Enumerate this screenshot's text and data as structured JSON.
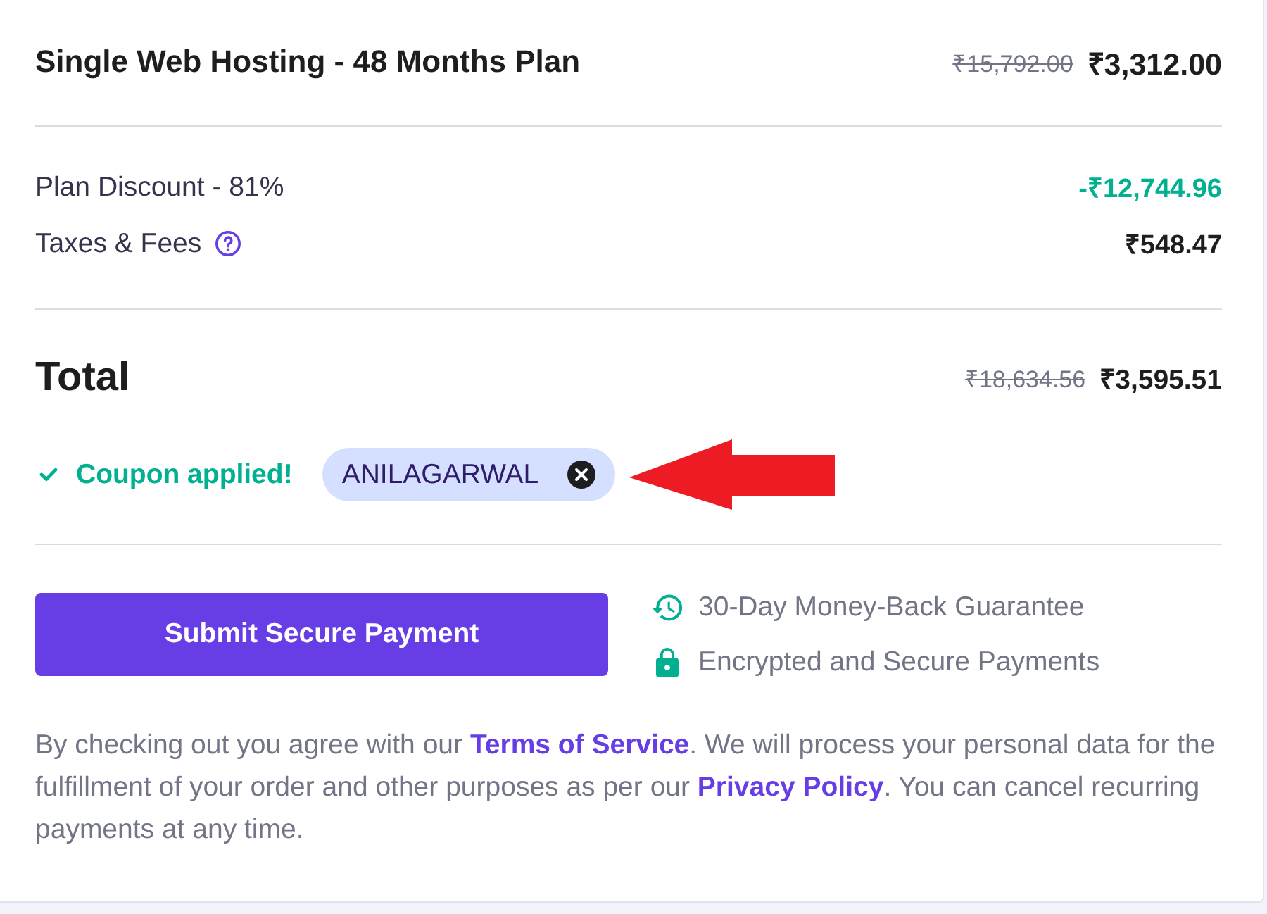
{
  "plan": {
    "name": "Single Web Hosting - 48 Months Plan",
    "original_price": "₹15,792.00",
    "price": "₹3,312.00"
  },
  "charges": [
    {
      "label": "Plan Discount - 81%",
      "amount": "-₹12,744.96",
      "kind": "discount",
      "help": false
    },
    {
      "label": "Taxes & Fees",
      "amount": "₹548.47",
      "kind": "fee",
      "help": true
    }
  ],
  "total": {
    "label": "Total",
    "original_price": "₹18,634.56",
    "price": "₹3,595.51"
  },
  "coupon": {
    "message": "Coupon applied!",
    "code": "ANILAGARWAL"
  },
  "submit_button": {
    "label": "Submit Secure Payment"
  },
  "assurances": [
    {
      "text": "30-Day Money-Back Guarantee",
      "kind": "money-back"
    },
    {
      "text": "Encrypted and Secure Payments",
      "kind": "secure"
    }
  ],
  "legal_notice": [
    {
      "kind": "text",
      "text": "By checking out you agree with our "
    },
    {
      "kind": "link",
      "text": "Terms of Service"
    },
    {
      "kind": "text",
      "text": ". We will process your personal data for the fulfillment of your order and other purposes as per our "
    },
    {
      "kind": "link",
      "text": "Privacy Policy"
    },
    {
      "kind": "text",
      "text": ". You can cancel recurring payments at any time."
    }
  ]
}
